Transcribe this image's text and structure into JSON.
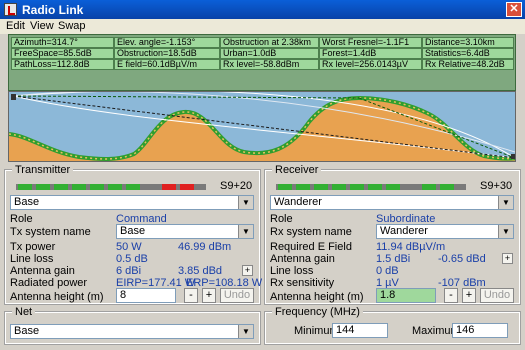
{
  "window": {
    "title": "Radio Link",
    "close_glyph": "✕"
  },
  "menu": [
    "Edit",
    "View",
    "Swap"
  ],
  "info_rows": [
    [
      "Azimuth=314.7°",
      "Elev. angle=-1.153°",
      "Obstruction at 2.38km",
      "Worst Fresnel=-1.1F1",
      "Distance=3.10km"
    ],
    [
      "FreeSpace=85.5dB",
      "Obstruction=18.5dB",
      "Urban=1.0dB",
      "Forest=1.4dB",
      "Statistics=6.4dB"
    ],
    [
      "PathLoss=112.8dB",
      "E field=60.1dBµV/m",
      "Rx level=-58.8dBm",
      "Rx level=256.0143µV",
      "Rx Relative=48.2dB"
    ]
  ],
  "colors": {
    "info_bg": "#9fd89c",
    "terrain": "#e8a250",
    "sky": "#8cb8d8",
    "signal_green": "#33b033",
    "signal_red": "#e02020"
  },
  "transmitter": {
    "legend": "Transmitter",
    "s_value": "S9+20",
    "meter": {
      "green_segments": 7,
      "red_segments": 2
    },
    "selected": "Base",
    "rows": [
      {
        "label": "Role",
        "v1": "Command",
        "v2": ""
      },
      {
        "label": "Tx system name",
        "v1": "Base",
        "v2": ""
      },
      {
        "label": "Tx power",
        "v1": "50 W",
        "v2": "46.99 dBm"
      },
      {
        "label": "Line loss",
        "v1": "0.5 dB",
        "v2": ""
      },
      {
        "label": "Antenna gain",
        "v1": "6 dBi",
        "v2": "3.85 dBd"
      },
      {
        "label": "Radiated power",
        "v1": "EIRP=177.41 W",
        "v2": "ERP=108.18 W"
      }
    ],
    "antenna_height_label": "Antenna height (m)",
    "antenna_height": "8",
    "minus": "-",
    "plus": "+",
    "undo": "Undo"
  },
  "receiver": {
    "legend": "Receiver",
    "s_value": "S9+30",
    "meter": {
      "green_segments": 9,
      "red_segments": 0
    },
    "selected": "Wanderer",
    "rows": [
      {
        "label": "Role",
        "v1": "Subordinate",
        "v2": ""
      },
      {
        "label": "Rx system name",
        "v1": "Wanderer",
        "v2": ""
      },
      {
        "label": "Required E Field",
        "v1": "11.94 dBµV/m",
        "v2": ""
      },
      {
        "label": "Antenna gain",
        "v1": "1.5 dBi",
        "v2": "-0.65 dBd"
      },
      {
        "label": "Line loss",
        "v1": "0 dB",
        "v2": ""
      },
      {
        "label": "Rx sensitivity",
        "v1": "1 µV",
        "v2": "-107 dBm"
      }
    ],
    "antenna_height_label": "Antenna height (m)",
    "antenna_height": "1.8",
    "minus": "-",
    "plus": "+",
    "undo": "Undo"
  },
  "net": {
    "legend": "Net",
    "selected": "Base"
  },
  "frequency": {
    "legend": "Frequency (MHz)",
    "min_label": "Minimum",
    "min_value": "144",
    "max_label": "Maximum",
    "max_value": "146"
  },
  "icons": {
    "dropdown": "▼",
    "small_plus": "+"
  }
}
